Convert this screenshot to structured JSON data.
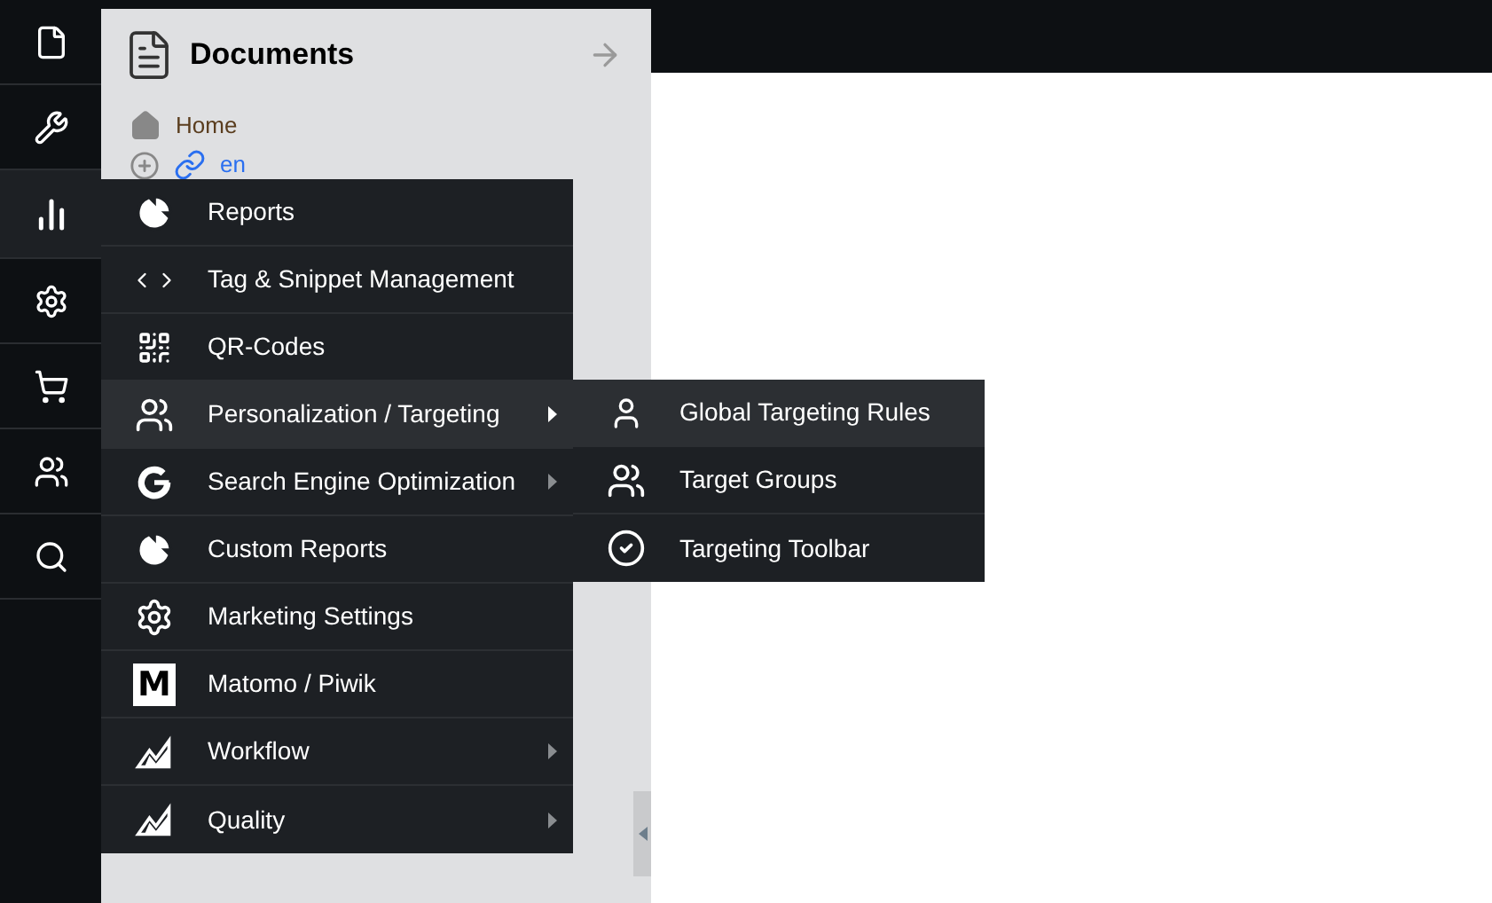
{
  "rail": [
    {
      "kind": "file",
      "selected": false
    },
    {
      "kind": "wrench",
      "selected": false
    },
    {
      "kind": "chart",
      "selected": true
    },
    {
      "kind": "gear",
      "selected": false
    },
    {
      "kind": "cart",
      "selected": false
    },
    {
      "kind": "users",
      "selected": false
    },
    {
      "kind": "search",
      "selected": false
    }
  ],
  "panel": {
    "title": "Documents",
    "tree": [
      {
        "kind": "home",
        "label": "Home"
      },
      {
        "kind": "link",
        "label": "en"
      }
    ]
  },
  "menu": [
    {
      "kind": "pie",
      "label": "Reports",
      "submenu": false,
      "selected": false
    },
    {
      "kind": "code",
      "label": "Tag & Snippet Management",
      "submenu": false,
      "selected": false
    },
    {
      "kind": "qr",
      "label": "QR-Codes",
      "submenu": false,
      "selected": false
    },
    {
      "kind": "group",
      "label": "Personalization / Targeting",
      "submenu": true,
      "selected": true
    },
    {
      "kind": "google",
      "label": "Search Engine Optimization",
      "submenu": true,
      "selected": false
    },
    {
      "kind": "pie",
      "label": "Custom Reports",
      "submenu": false,
      "selected": false
    },
    {
      "kind": "gear",
      "label": "Marketing Settings",
      "submenu": false,
      "selected": false
    },
    {
      "kind": "letter",
      "badge": "M",
      "label": "Matomo / Piwik",
      "submenu": false,
      "selected": false
    },
    {
      "kind": "trend",
      "label": "Workflow",
      "submenu": true,
      "selected": false
    },
    {
      "kind": "trend",
      "label": "Quality",
      "submenu": true,
      "selected": false
    }
  ],
  "submenu": [
    {
      "kind": "user",
      "label": "Global Targeting Rules",
      "selected": true
    },
    {
      "kind": "group",
      "label": "Target Groups",
      "selected": false
    },
    {
      "kind": "check",
      "label": "Targeting Toolbar",
      "selected": false
    }
  ]
}
